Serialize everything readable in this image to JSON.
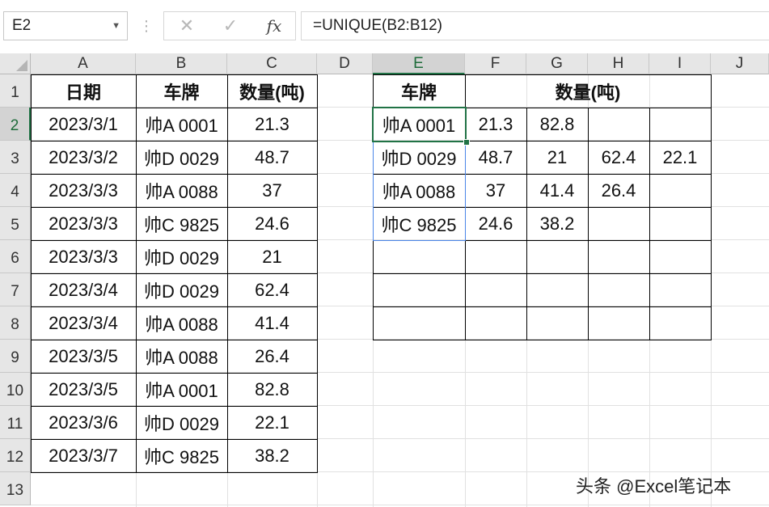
{
  "namebox": {
    "value": "E2"
  },
  "formula_bar": {
    "cancel_icon": "close-icon",
    "enter_icon": "check-icon",
    "fx_label": "fx",
    "formula": "=UNIQUE(B2:B12)"
  },
  "columns": [
    "A",
    "B",
    "C",
    "D",
    "E",
    "F",
    "G",
    "H",
    "I",
    "J"
  ],
  "rows": [
    "1",
    "2",
    "3",
    "4",
    "5",
    "6",
    "7",
    "8",
    "9",
    "10",
    "11",
    "12",
    "13"
  ],
  "selected_cell": "E2",
  "left_table": {
    "headers": [
      "日期",
      "车牌",
      "数量(吨)"
    ],
    "rows": [
      [
        "2023/3/1",
        "帅A 0001",
        "21.3"
      ],
      [
        "2023/3/2",
        "帅D 0029",
        "48.7"
      ],
      [
        "2023/3/3",
        "帅A 0088",
        "37"
      ],
      [
        "2023/3/3",
        "帅C 9825",
        "24.6"
      ],
      [
        "2023/3/3",
        "帅D 0029",
        "21"
      ],
      [
        "2023/3/4",
        "帅D 0029",
        "62.4"
      ],
      [
        "2023/3/4",
        "帅A 0088",
        "41.4"
      ],
      [
        "2023/3/5",
        "帅A 0088",
        "26.4"
      ],
      [
        "2023/3/5",
        "帅A 0001",
        "82.8"
      ],
      [
        "2023/3/6",
        "帅D 0029",
        "22.1"
      ],
      [
        "2023/3/7",
        "帅C 9825",
        "38.2"
      ]
    ]
  },
  "right_table": {
    "header_plate": "车牌",
    "header_qty": "数量(吨)",
    "rows": [
      [
        "帅A 0001",
        "21.3",
        "82.8",
        "",
        ""
      ],
      [
        "帅D 0029",
        "48.7",
        "21",
        "62.4",
        "22.1"
      ],
      [
        "帅A 0088",
        "37",
        "41.4",
        "26.4",
        ""
      ],
      [
        "帅C 9825",
        "24.6",
        "38.2",
        "",
        ""
      ],
      [
        "",
        "",
        "",
        "",
        ""
      ],
      [
        "",
        "",
        "",
        "",
        ""
      ],
      [
        "",
        "",
        "",
        "",
        ""
      ]
    ]
  },
  "watermark": "头条 @Excel笔记本"
}
